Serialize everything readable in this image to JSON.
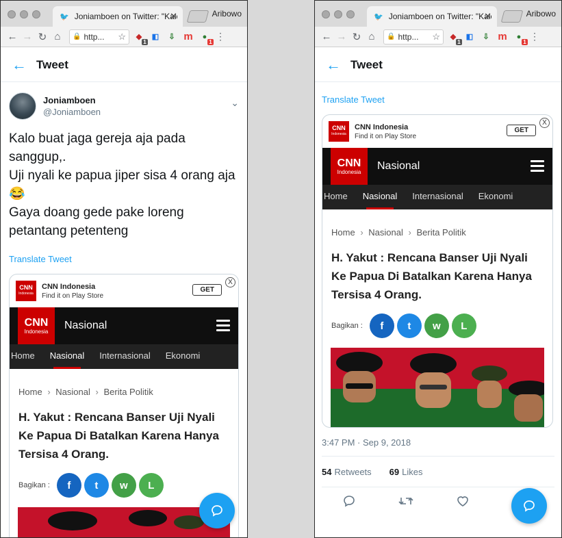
{
  "browser": {
    "tab_title": "Joniamboen on Twitter: \"Kalo",
    "profile_name": "Aribowo",
    "url_text": "http...",
    "ext_badge_1": "1",
    "ext_badge_5": "1"
  },
  "tweet_header": {
    "back_icon": "←",
    "title": "Tweet"
  },
  "author": {
    "display_name": "Joniamboen",
    "handle": "@Joniamboen"
  },
  "tweet": {
    "line1": "Kalo buat jaga gereja aja pada sanggup,.",
    "line2": "Uji nyali ke papua jiper sisa 4 orang aja",
    "emoji": "😂",
    "line3": "Gaya doang gede pake loreng petantang petenteng",
    "translate": "Translate Tweet"
  },
  "card": {
    "ad_name": "CNN Indonesia",
    "ad_sub": "Find it on Play Store",
    "get_label": "GET",
    "close_label": "X",
    "logo_text": "CNN",
    "logo_sub": "Indonesia",
    "section": "Nasional",
    "tabs": [
      "Home",
      "Nasional",
      "Internasional",
      "Ekonomi"
    ],
    "breadcrumbs": [
      "Home",
      "Nasional",
      "Berita Politik"
    ],
    "crumb_sep": "›",
    "headline": "H. Yakut : Rencana Banser Uji Nyali Ke Papua Di Batalkan Karena Hanya Tersisa 4 Orang.",
    "share_label": "Bagikan :",
    "share_glyphs": [
      "f",
      "t",
      "w",
      "L"
    ]
  },
  "meta": {
    "time": "3:47 PM · Sep 9, 2018",
    "retweets_count": "54",
    "retweets_label": "Retweets",
    "likes_count": "69",
    "likes_label": "Likes"
  },
  "colors": {
    "twitter_blue": "#1da1f2",
    "cnn_red": "#cc0000",
    "facebook": "#1565c0",
    "twitter_share": "#1e88e5",
    "whatsapp": "#43a047",
    "line": "#4caf50"
  }
}
